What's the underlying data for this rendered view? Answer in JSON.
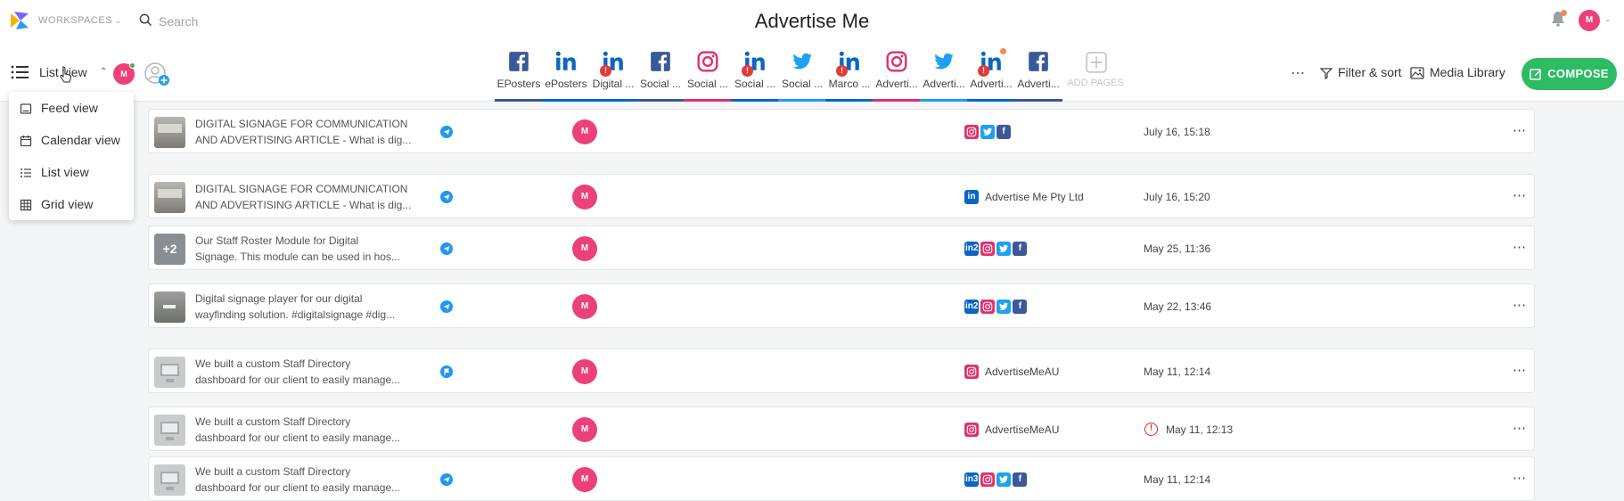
{
  "topbar": {
    "workspaces_label": "WORKSPACES",
    "search_placeholder": "Search",
    "title": "Advertise Me",
    "avatar_initial": "M"
  },
  "toolbar": {
    "view_label": "List view",
    "avatar_initial": "M",
    "pages": [
      {
        "label": "EPosters",
        "icon": "facebook-icon",
        "color": "#3b5998",
        "warning": false
      },
      {
        "label": "ePosters",
        "icon": "linkedin-icon",
        "color": "#0a66c2",
        "warning": false
      },
      {
        "label": "Digital ...",
        "icon": "linkedin-icon",
        "color": "#0a66c2",
        "warning": true
      },
      {
        "label": "Social ...",
        "icon": "facebook-icon",
        "color": "#3b5998",
        "warning": false
      },
      {
        "label": "Social ...",
        "icon": "instagram-icon",
        "color": "#e1306c",
        "warning": false
      },
      {
        "label": "Social ...",
        "icon": "linkedin-icon",
        "color": "#0a66c2",
        "warning": true
      },
      {
        "label": "Social ...",
        "icon": "twitter-icon",
        "color": "#1da1f2",
        "warning": false
      },
      {
        "label": "Marco ...",
        "icon": "linkedin-icon",
        "color": "#0a66c2",
        "warning": true
      },
      {
        "label": "Adverti...",
        "icon": "instagram-icon",
        "color": "#e1306c",
        "warning": false
      },
      {
        "label": "Adverti...",
        "icon": "twitter-icon",
        "color": "#1da1f2",
        "warning": false
      },
      {
        "label": "Adverti...",
        "icon": "linkedin-icon",
        "color": "#0a66c2",
        "warning": true
      },
      {
        "label": "Adverti...",
        "icon": "facebook-icon",
        "color": "#3b5998",
        "warning": false
      }
    ],
    "add_pages_label": "ADD PAGES",
    "filter_label": "Filter & sort",
    "media_label": "Media Library",
    "compose_label": "COMPOSE"
  },
  "view_menu": [
    {
      "label": "Feed view",
      "icon": "feed-view-icon"
    },
    {
      "label": "Calendar view",
      "icon": "calendar-icon"
    },
    {
      "label": "List view",
      "icon": "list-icon"
    },
    {
      "label": "Grid view",
      "icon": "grid-icon"
    }
  ],
  "posts": [
    {
      "line1": "DIGITAL SIGNAGE FOR COMMUNICATION",
      "line2": "AND ADVERTISING ARTICLE - What is dig...",
      "status": "sent",
      "author": "M",
      "networks": [
        "instagram",
        "twitter",
        "facebook"
      ],
      "account": "",
      "date": "July 16, 15:18",
      "error": false,
      "thumb": "room"
    },
    {
      "line1": "DIGITAL SIGNAGE FOR COMMUNICATION",
      "line2": "AND ADVERTISING ARTICLE - What is dig...",
      "status": "sent",
      "author": "M",
      "networks": [
        "linkedin"
      ],
      "account": "Advertise Me Pty Ltd",
      "date": "July 16, 15:20",
      "error": false,
      "thumb": "room"
    },
    {
      "line1": "Our Staff Roster Module for Digital",
      "line2": "Signage. This module can be used in hos...",
      "status": "sent",
      "author": "M",
      "networks": [
        "in2",
        "instagram",
        "twitter",
        "facebook"
      ],
      "account": "",
      "date": "May 25, 11:36",
      "error": false,
      "thumb": "+2"
    },
    {
      "line1": "Digital signage player for our digital",
      "line2": "wayfinding solution. #digitalsignage #dig...",
      "status": "sent",
      "author": "M",
      "networks": [
        "in2",
        "instagram",
        "twitter",
        "facebook"
      ],
      "account": "",
      "date": "May 22, 13:46",
      "error": false,
      "thumb": "device"
    },
    {
      "line1": "We built a custom Staff Directory",
      "line2": "dashboard for our client to easily manage...",
      "status": "flag",
      "author": "M",
      "networks": [
        "instagram"
      ],
      "account": "AdvertiseMeAU",
      "date": "May 11, 12:14",
      "error": false,
      "thumb": "screen"
    },
    {
      "line1": "We built a custom Staff Directory",
      "line2": "dashboard for our client to easily manage...",
      "status": "none",
      "author": "M",
      "networks": [
        "instagram"
      ],
      "account": "AdvertiseMeAU",
      "date": "May 11, 12:13",
      "error": true,
      "thumb": "screen"
    },
    {
      "line1": "We built a custom Staff Directory",
      "line2": "dashboard for our client to easily manage...",
      "status": "sent",
      "author": "M",
      "networks": [
        "in3",
        "instagram",
        "twitter",
        "facebook"
      ],
      "account": "",
      "date": "May 11, 12:14",
      "error": false,
      "thumb": "screen"
    }
  ]
}
